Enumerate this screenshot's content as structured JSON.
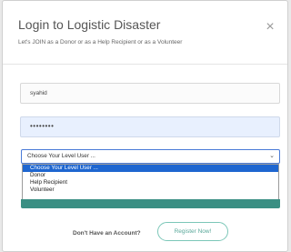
{
  "modal": {
    "title": "Login to Logistic Disaster",
    "subtitle": "Let's JOIN as a Donor or as a Help Recipient or as a Volunteer",
    "close_symbol": "×"
  },
  "form": {
    "username_value": "syahid",
    "password_value": "••••••••",
    "level_select": {
      "selected": "Choose Your Level User ...",
      "options": [
        "Choose Your Level User ...",
        "Donor",
        "Help Recipient",
        "Volunteer"
      ]
    }
  },
  "footer": {
    "prompt": "Don't Have an Account?",
    "register_label": "Register Now!"
  },
  "colors": {
    "accent": "#3a8f83",
    "select_highlight": "#1e66d0",
    "register_border": "#7cc7b8"
  }
}
